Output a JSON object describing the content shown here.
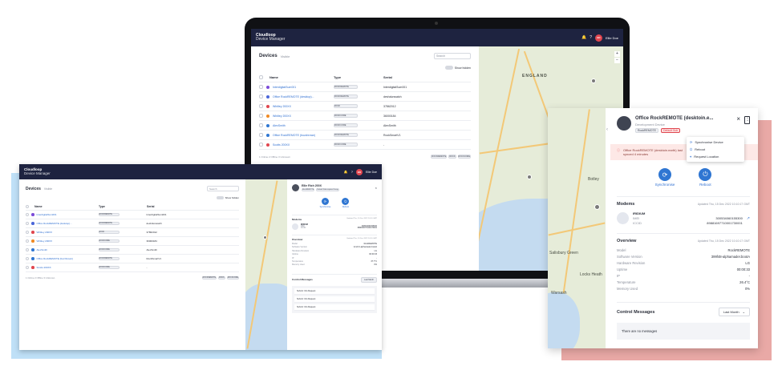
{
  "app": {
    "brand_line1": "Cloudloop",
    "brand_line2": "Device Manager",
    "user_name": "Ellie Doe",
    "avatar_initial": "ED"
  },
  "devices": {
    "title": "Devices",
    "subtitle": "Visible",
    "search_placeholder": "Search",
    "show_hidden_label": "Show hidden",
    "columns": [
      "Name",
      "Type",
      "Serial"
    ],
    "rows": [
      {
        "name": "InterdigitalSum001",
        "sub": "",
        "type": "ROCKREMOTE",
        "serial": "InterdigitalSum001",
        "color": "#7b4bd9"
      },
      {
        "name": "Office RockREMOTE (desktop)...",
        "sub": "Development Device",
        "type": "ROCKREMOTE",
        "serial": "deshdunwatch",
        "color": "#4b66d9"
      },
      {
        "name": "Whitley 200XX",
        "sub": "Development Device",
        "type": "ROCK",
        "serial": "37862012",
        "color": "#e0464f"
      },
      {
        "name": "Whitley 200XX",
        "sub": "Development Device",
        "type": "ROCKCORE",
        "serial": "36000184",
        "color": "#f08a24"
      },
      {
        "name": "AlexSmith",
        "sub": "",
        "type": "ROCKCORE",
        "serial": "AlexSmith",
        "color": "#2f76d2"
      },
      {
        "name": "Office RockREMOTE (buzzbrown)",
        "sub": "",
        "type": "ROCKREMOTE",
        "serial": "RockSmartV1",
        "color": "#2f76d2"
      },
      {
        "name": "Scotts 200XX",
        "sub": "",
        "type": "ROCKCORE",
        "serial": "-",
        "color": "#e0464f"
      }
    ],
    "footer_left": "1 Online   2 Offline   3 Unknown",
    "footer_buttons": [
      "ROCKREMOTE",
      "ROCK",
      "ROCKCORE"
    ]
  },
  "map_labels": {
    "england": "ENGLAND",
    "botley": "Botley",
    "salisbury_green": "Salisbury Green",
    "locks_heath": "Locks Heath",
    "warsash": "Warsash"
  },
  "detail_small": {
    "title": "Ellie Rich 200X",
    "tag1": "RockREMOTE",
    "tag2": "Default Subscription Group",
    "action1": "Synchronise",
    "action2": "Reboot",
    "modems_title": "Modems",
    "modems_updated": "Updated Thu, 10 Dec 2022 10:10 GMT",
    "modem_name": "IRIDIUM",
    "imei_label": "IMEI",
    "imei": "300534060155300",
    "iccid_label": "ICCID",
    "iccid": "8988169771000173001",
    "overview_title": "Overview",
    "overview_updated": "Updated Thu, 10 Dec 2022 10:10 GMT",
    "overview_rows": [
      [
        "Model",
        "RockREMOTE"
      ],
      [
        "Software Version",
        "v0.22.0-alphamader.bootA"
      ],
      [
        "Hardware Revision",
        "LG"
      ],
      [
        "Uptime",
        "00:00:33"
      ],
      [
        "IP",
        "-"
      ],
      [
        "Temperature",
        "37.7°C"
      ],
      [
        "Memory Used",
        "0%"
      ]
    ],
    "control_title": "Control Messages",
    "control_select": "Last Month",
    "control_items": [
      "Submit: Info Request",
      "Submit: Info Request",
      "Submit: Info Request"
    ]
  },
  "detail_large": {
    "title": "Office RockREMOTE (desktoin.e...",
    "subtitle": "Development Device",
    "tag1": "RockREMOTE",
    "tag2": "Default Sub",
    "menu": [
      "Synchronise Device",
      "Reboot",
      "Request Location"
    ],
    "alert": "Office RockREMOTE (desktoin.earth) last synced 4 minutes",
    "action1": "Synchronise",
    "action2": "Reboot",
    "modems_title": "Modems",
    "modems_updated": "Updated Thu, 15 Dec 2022 10:10:17 GMT",
    "modem_name": "IRIDIUM",
    "imei_label": "IMEI",
    "imei": "300534060155300",
    "iccid_label": "ICCID",
    "iccid": "89881697710001730001",
    "overview_title": "Overview",
    "overview_updated": "Updated Thu, 15 Dec 2022 10:10:17 GMT",
    "overview_rows": [
      [
        "Model",
        "RockREMOTE"
      ],
      [
        "Software Version",
        "399f48-alphamader.bootA"
      ],
      [
        "Hardware Revision",
        "LG"
      ],
      [
        "Uptime",
        "00:00:33"
      ],
      [
        "IP",
        "-"
      ],
      [
        "Temperature",
        "26.4°C"
      ],
      [
        "Memory Used",
        "0%"
      ]
    ],
    "control_title": "Control Messages",
    "control_select": "Last Month",
    "no_messages": "There are no messages"
  },
  "colors": {
    "header": "#1e2340",
    "accent": "#2f76d2",
    "danger": "#e0464f",
    "back_blue": "#bfe0f7",
    "back_red": "#e9a9a6"
  }
}
